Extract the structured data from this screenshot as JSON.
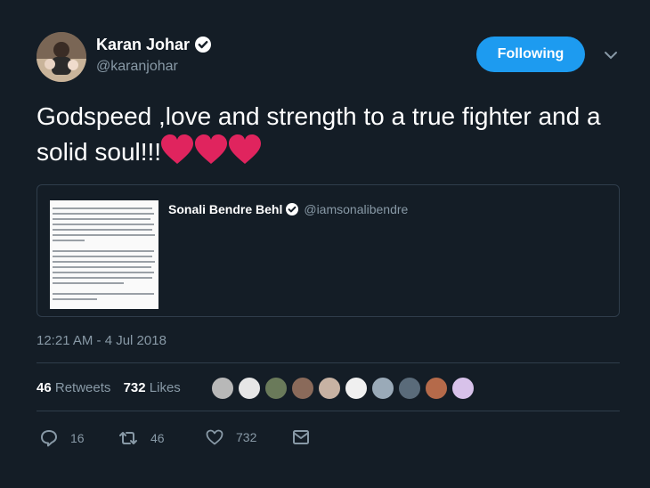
{
  "author": {
    "name": "Karan Johar",
    "handle": "@karanjohar",
    "verified": true
  },
  "follow_button": {
    "label": "Following",
    "color": "#1d9bf0"
  },
  "tweet": {
    "text": "Godspeed ,love and strength to a true fighter and a solid soul!!!",
    "emoji": [
      "red-heart",
      "red-heart",
      "red-heart"
    ],
    "timestamp": "12:21 AM - 4 Jul 2018"
  },
  "quoted_tweet": {
    "name": "Sonali Bendre Behl",
    "handle": "@iamsonalibendre",
    "verified": true,
    "attachment": "text-document-image"
  },
  "stats": {
    "retweets_count": "46",
    "retweets_label": "Retweets",
    "likes_count": "732",
    "likes_label": "Likes"
  },
  "actions": {
    "reply_count": "16",
    "retweet_count": "46",
    "like_count": "732"
  },
  "colors": {
    "background": "#141d26",
    "text": "#ffffff",
    "muted": "#8899a6",
    "border": "#2f3d4b",
    "heart": "#e0245e"
  }
}
